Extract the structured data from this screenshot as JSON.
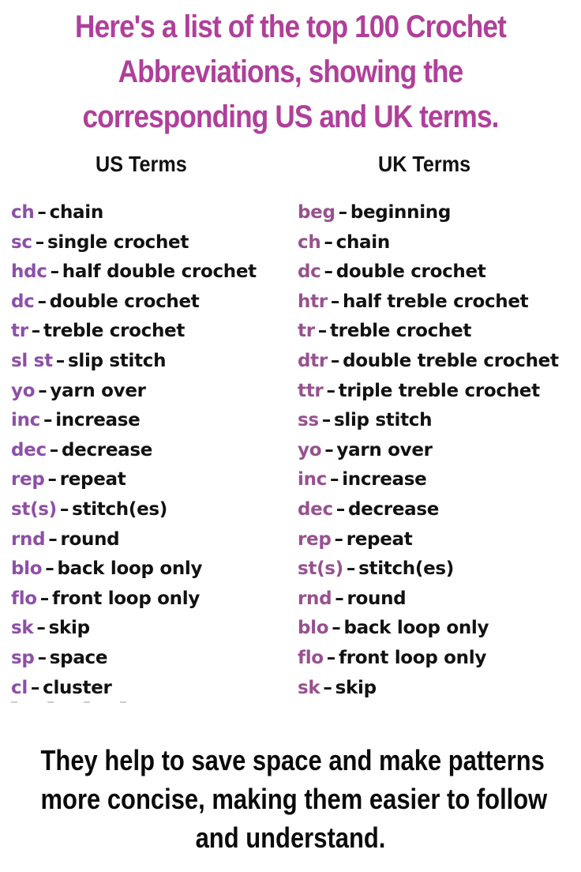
{
  "title": {
    "lines": [
      "Here's a list of the top 100 Crochet",
      "Abbreviations, showing the",
      "corresponding US and UK terms."
    ],
    "color": "#b03f9a"
  },
  "us": {
    "heading": "US Terms",
    "items": [
      {
        "abbr": "ch",
        "term": "chain"
      },
      {
        "abbr": "sc",
        "term": "single crochet"
      },
      {
        "abbr": "hdc",
        "term": "half double crochet"
      },
      {
        "abbr": "dc",
        "term": "double crochet"
      },
      {
        "abbr": "tr",
        "term": "treble crochet"
      },
      {
        "abbr": "sl st",
        "term": "slip stitch"
      },
      {
        "abbr": "yo",
        "term": "yarn over"
      },
      {
        "abbr": "inc",
        "term": "increase"
      },
      {
        "abbr": "dec",
        "term": "decrease"
      },
      {
        "abbr": "rep",
        "term": "repeat"
      },
      {
        "abbr": "st(s)",
        "term": "stitch(es)"
      },
      {
        "abbr": "rnd",
        "term": "round"
      },
      {
        "abbr": "blo",
        "term": "back loop only"
      },
      {
        "abbr": "flo",
        "term": "front loop only"
      },
      {
        "abbr": "sk",
        "term": "skip"
      },
      {
        "abbr": "sp",
        "term": "space"
      },
      {
        "abbr": "cl",
        "term": "cluster"
      }
    ]
  },
  "uk": {
    "heading": "UK Terms",
    "items": [
      {
        "abbr": "beg",
        "term": "beginning"
      },
      {
        "abbr": "ch",
        "term": "chain"
      },
      {
        "abbr": "dc",
        "term": "double crochet"
      },
      {
        "abbr": "htr",
        "term": "half treble crochet"
      },
      {
        "abbr": "tr",
        "term": "treble crochet"
      },
      {
        "abbr": "dtr",
        "term": "double treble crochet"
      },
      {
        "abbr": "ttr",
        "term": "triple treble crochet"
      },
      {
        "abbr": "ss",
        "term": "slip stitch"
      },
      {
        "abbr": "yo",
        "term": "yarn over"
      },
      {
        "abbr": "inc",
        "term": "increase"
      },
      {
        "abbr": "dec",
        "term": "decrease"
      },
      {
        "abbr": "rep",
        "term": "repeat"
      },
      {
        "abbr": "st(s)",
        "term": "stitch(es)"
      },
      {
        "abbr": "rnd",
        "term": "round"
      },
      {
        "abbr": "blo",
        "term": "back loop only"
      },
      {
        "abbr": "flo",
        "term": "front loop only"
      },
      {
        "abbr": "sk",
        "term": "skip"
      }
    ]
  },
  "separator": "–",
  "footer": {
    "lines": [
      "They help to save space and make patterns",
      "more concise, making them easier to follow",
      "and understand."
    ]
  }
}
